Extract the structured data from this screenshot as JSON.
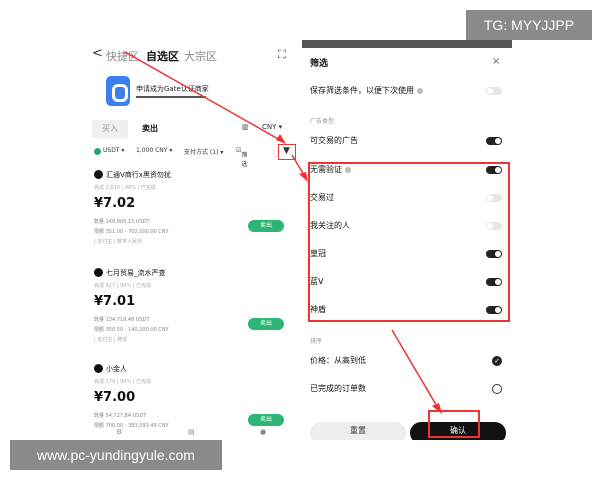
{
  "watermark": {
    "top": "TG: MYYJJPP",
    "bottom": "www.pc-yundingyule.com"
  },
  "left": {
    "nav": {
      "back": "<",
      "tabs": [
        "快捷区",
        "自选区",
        "大宗区"
      ],
      "scan_icon": "scan-icon"
    },
    "banner": {
      "text": "申请成为Gate认证商家"
    },
    "trade_tabs": {
      "buy": "买入",
      "sell": "卖出"
    },
    "currency": "CNY ▾",
    "filters": {
      "coin": "USDT ▾",
      "amount": "1,000 CNY ▾",
      "payment": "支付方式 (1) ▾",
      "filter_label": "筛选"
    },
    "ads": [
      {
        "name": "汇通V商行x黑资勿扰",
        "meta": "完成 2,610 | 99% | 已完成",
        "price": "¥7.02",
        "qty": "数量 148,806.15 USDT",
        "limit": "限额 351.00 - 702,000.00 CNY",
        "pay": "| 支付宝 | 数字人民币",
        "button": "卖出"
      },
      {
        "name": "七月贸易_流水严查",
        "meta": "完成 627 | 99% | 已完成",
        "price": "¥7.01",
        "qty": "数量 134,718.48 USDT",
        "limit": "限额 350.50 - 140,200.00 CNY",
        "pay": "| 支付宝 | 微信",
        "button": "卖出"
      },
      {
        "name": "小金人",
        "meta": "完成 174 | 99% | 已完成",
        "price": "¥7.00",
        "qty": "数量 54,727.84 USDT",
        "limit": "限额 700.00 - 383,093.49 CNY",
        "pay": "",
        "button": "卖出"
      }
    ]
  },
  "right": {
    "title": "筛选",
    "close": "×",
    "save_label": "保存筛选条件，以便下次使用",
    "section_ad": "广告类型",
    "rows": [
      {
        "label": "可交易的广告",
        "on": true
      },
      {
        "label": "无需验证",
        "on": true,
        "info": true
      },
      {
        "label": "交易过",
        "on": false
      },
      {
        "label": "我关注的人",
        "on": false
      },
      {
        "label": "皇冠",
        "on": true
      },
      {
        "label": "蓝V",
        "on": true
      },
      {
        "label": "神盾",
        "on": true
      }
    ],
    "section_sort": "排序",
    "sort": [
      {
        "label": "价格：从高到低",
        "checked": true
      },
      {
        "label": "已完成的订单数",
        "checked": false
      }
    ],
    "reset": "重置",
    "confirm": "确认",
    "colors": {
      "accent": "#2bb673",
      "highlight": "#e33333"
    }
  }
}
